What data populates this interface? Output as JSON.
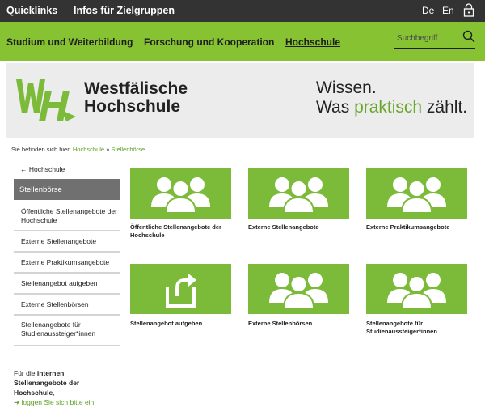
{
  "topbar": {
    "quicklinks": "Quicklinks",
    "infos": "Infos für Zielgruppen",
    "lang_de": "De",
    "lang_en": "En",
    "lock_icon": "lock-icon"
  },
  "nav": {
    "items": [
      "Studium und Weiterbildung",
      "Forschung und Kooperation",
      "Hochschule"
    ],
    "active": "Hochschule",
    "search_placeholder": "Suchbegriff"
  },
  "banner": {
    "name_line1": "Westfälische",
    "name_line2": "Hochschule",
    "slogan_line1": "Wissen.",
    "slogan_pre": "Was ",
    "slogan_accent": "praktisch",
    "slogan_post": " zählt.",
    "accent_color": "#6aa62a"
  },
  "breadcrumb": {
    "prefix": "Sie befinden sich hier:",
    "item1": "Hochschule",
    "sep": "»",
    "item2": "Stellenbörse"
  },
  "sidebar": {
    "back": "Hochschule",
    "active": "Stellenbörse",
    "items": [
      "Öffentliche Stellenangebote der Hochschule",
      "Externe Stellenangebote",
      "Externe Praktikumsangebote",
      "Stellenangebot aufgeben",
      "Externe Stellenbörsen",
      "Stellenangebote für Studienaussteiger*innen"
    ]
  },
  "login": {
    "line1_pre": "Für die ",
    "line1_bold": "internen",
    "line2_bold": "Stellenangebote der",
    "line3_bold": "Hochschule",
    "line3_post": ",",
    "link": "loggen Sie sich bitte ein."
  },
  "tiles": [
    {
      "label": "Öffentliche Stellenangebote der Hochschule",
      "icon": "people-icon"
    },
    {
      "label": "Externe Stellenangebote",
      "icon": "people-icon"
    },
    {
      "label": "Externe Praktikumsangebote",
      "icon": "people-icon"
    },
    {
      "label": "Stellenangebot aufgeben",
      "icon": "upload-icon"
    },
    {
      "label": "Externe Stellenbörsen",
      "icon": "people-icon"
    },
    {
      "label": "Stellenangebote für Studienaussteiger*innen",
      "icon": "people-icon"
    }
  ],
  "colors": {
    "topbar": "#333333",
    "nav": "#86c232",
    "tile": "#7cbb3a",
    "link": "#5a9e1e",
    "sidebar_active": "#707070"
  }
}
